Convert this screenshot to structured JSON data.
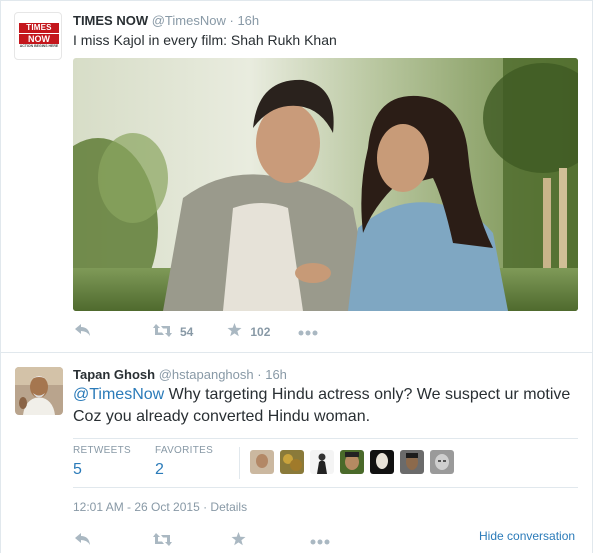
{
  "tweet1": {
    "avatar_logo_text_1": "TIMES",
    "avatar_logo_text_2": "NOW",
    "avatar_logo_tagline": "ACTION BEGINS HERE",
    "name": "TIMES NOW",
    "handle": "@TimesNow",
    "separator": "·",
    "time": "16h",
    "text": "I miss Kajol in every film: Shah Rukh Khan",
    "retweet_count": "54",
    "favorite_count": "102"
  },
  "tweet2": {
    "name": "Tapan Ghosh",
    "handle": "@hstapanghosh",
    "separator": "·",
    "time": "16h",
    "mention": "@TimesNow",
    "text_line1": " Why targeting Hindu actress only? We suspect ur motive",
    "text_line2": "Coz you already converted Hindu woman.",
    "stats": {
      "retweets_label": "RETWEETS",
      "retweets_value": "5",
      "favorites_label": "FAVORITES",
      "favorites_value": "2"
    },
    "timestamp": "12:01 AM - 26 Oct 2015",
    "meta_sep": " · ",
    "details_link": "Details",
    "hide_conversation": "Hide conversation"
  },
  "icons": {
    "reply": "reply-icon",
    "retweet": "retweet-icon",
    "favorite": "star-icon",
    "more": "more-icon"
  },
  "colors": {
    "link": "#2b7bb9",
    "muted": "#8899a6",
    "icon": "#aab8c2",
    "border": "#e1e8ed",
    "times_red": "#c4161c"
  }
}
